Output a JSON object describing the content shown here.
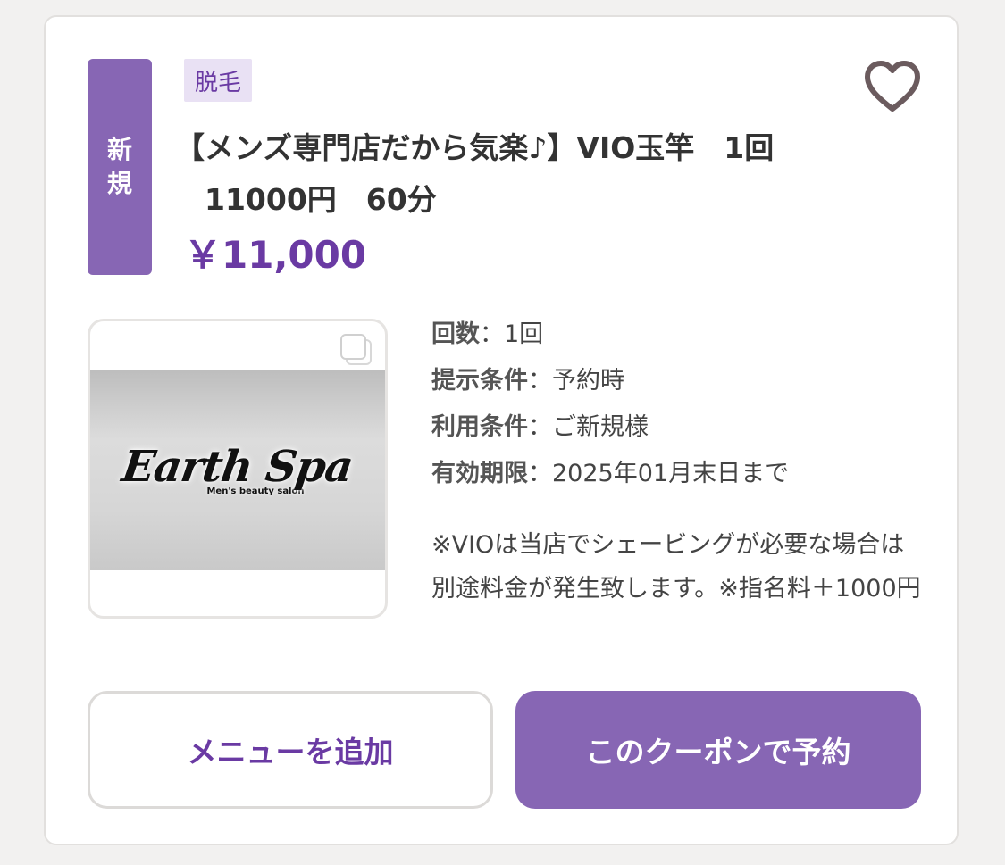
{
  "colors": {
    "accent": "#8766b4",
    "accent_text": "#6a3aa3",
    "tag_bg": "#e9e1f4",
    "heart": "#6b5b5e"
  },
  "coupon": {
    "badge_chars": [
      "新",
      "規"
    ],
    "category": "脱毛",
    "title_line1": "【メンズ専門店だから気楽♪】VIO玉竿　1回",
    "title_line2": "　11000円　60分",
    "price": "￥11,000",
    "favorite_icon": "heart-outline-icon",
    "image": {
      "logo_text": "Earth Spa",
      "logo_subtext": "Men's beauty salon",
      "gallery_icon": "stacked-squares-icon"
    },
    "details": [
      {
        "label": "回数",
        "sep": "：",
        "value": "1回"
      },
      {
        "label": "提示条件",
        "sep": "：",
        "value": "予約時"
      },
      {
        "label": "利用条件",
        "sep": "：",
        "value": "ご新規様"
      },
      {
        "label": "有効期限",
        "sep": "：",
        "value": "2025年01月末日まで"
      }
    ],
    "note": "※VIOは当店でシェービングが必要な場合は別途料金が発生致します。※指名料＋1000円"
  },
  "buttons": {
    "add_menu": "メニューを追加",
    "reserve": "このクーポンで予約"
  }
}
